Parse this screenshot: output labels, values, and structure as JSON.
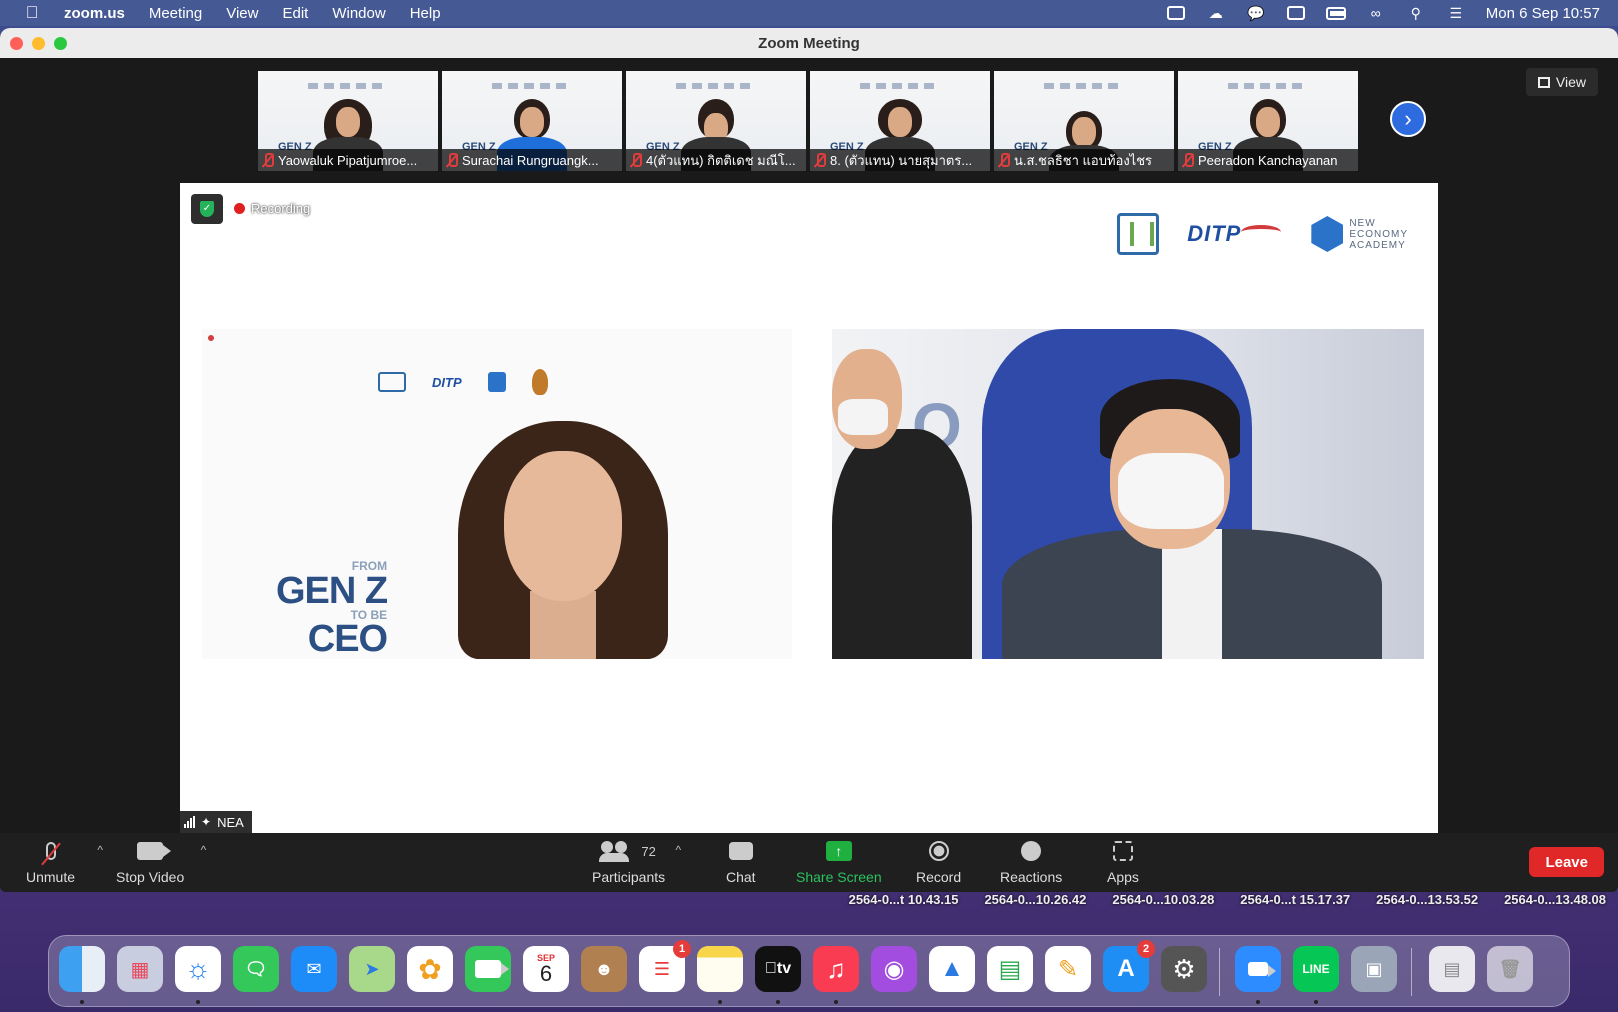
{
  "menubar": {
    "apple_icon": "apple-logo-icon",
    "items": [
      "zoom.us",
      "Meeting",
      "View",
      "Edit",
      "Window",
      "Help"
    ],
    "tray_icons": [
      "zoom-tray-icon",
      "creative-cloud-icon",
      "line-tray-icon",
      "notion-icon",
      "battery-icon",
      "link-icon",
      "search-icon",
      "control-center-icon"
    ],
    "clock": "Mon 6 Sep  10:57"
  },
  "window": {
    "title": "Zoom Meeting",
    "view_button": "View"
  },
  "participants_strip": [
    {
      "name": "Yaowaluk Pipatjumroe...",
      "muted": true
    },
    {
      "name": "Surachai Rungruangk...",
      "muted": true
    },
    {
      "name": "4(ตัวแทน) กิตติเดช มณีโ...",
      "muted": true
    },
    {
      "name": "8. (ตัวแทน) นายสุมาตร...",
      "muted": true
    },
    {
      "name": "น.ส.ชลธิชา แอบท้องไชร",
      "muted": true
    },
    {
      "name": "Peeradon Kanchayanan",
      "muted": true
    }
  ],
  "main_video": {
    "recording_label": "Recording",
    "slide_logo_text": "DITP",
    "nea_logo_text": "NEW\nECONOMY\nACADEMY",
    "genz_from": "FROM",
    "genz_big": "GEN Z",
    "genz_tobe": "TO BE",
    "genz_ceo": "CEO",
    "backdrop_letters": "O BE",
    "speaker_name": "NEA"
  },
  "toolbar": {
    "unmute": "Unmute",
    "stop_video": "Stop Video",
    "participants": "Participants",
    "participants_count": "72",
    "chat": "Chat",
    "share_screen": "Share Screen",
    "record": "Record",
    "reactions": "Reactions",
    "apps": "Apps",
    "leave": "Leave",
    "caret": "^"
  },
  "desktop_files": [
    "2564-0...t 10.43.15",
    "2564-0...10.26.42",
    "2564-0...10.03.28",
    "2564-0...t 15.17.37",
    "2564-0...13.53.52",
    "2564-0...13.48.08"
  ],
  "dock": {
    "calendar_month": "SEP",
    "calendar_day": "6",
    "reminders_badge": "1",
    "appstore_badge": "2",
    "appletv_label": "tv"
  }
}
